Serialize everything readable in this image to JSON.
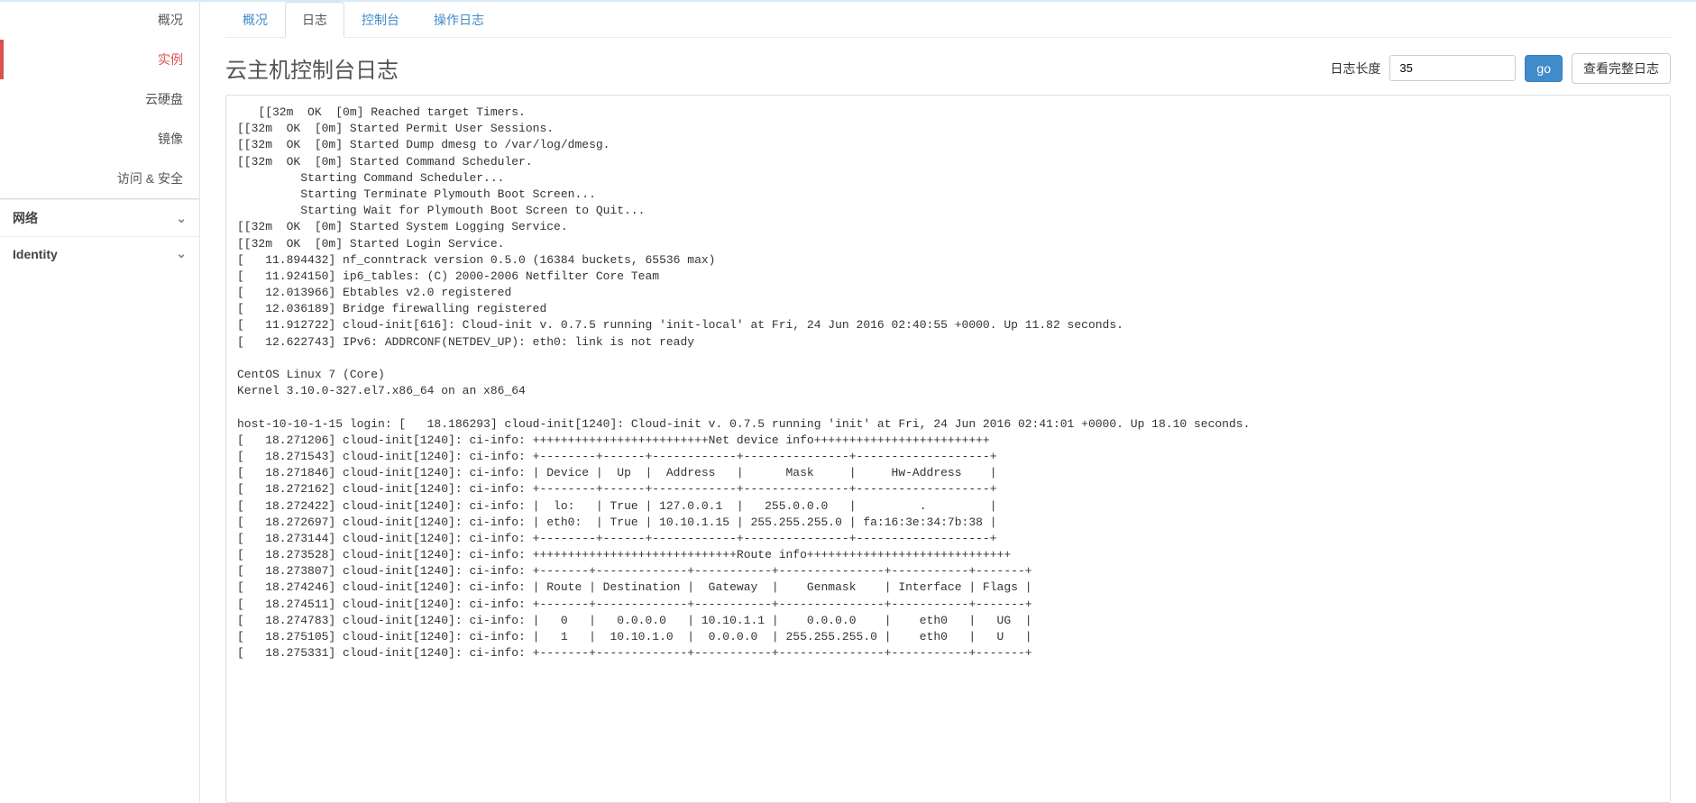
{
  "sidebar": {
    "items": [
      {
        "label": "概况"
      },
      {
        "label": "实例"
      },
      {
        "label": "云硬盘"
      },
      {
        "label": "镜像"
      },
      {
        "label": "访问 & 安全"
      }
    ],
    "groups": [
      {
        "label": "网络"
      },
      {
        "label": "Identity"
      }
    ]
  },
  "tabs": [
    {
      "label": "概况"
    },
    {
      "label": "日志"
    },
    {
      "label": "控制台"
    },
    {
      "label": "操作日志"
    }
  ],
  "page_title": "云主机控制台日志",
  "log_length": {
    "label": "日志长度",
    "value": "35"
  },
  "buttons": {
    "go": "go",
    "view_full": "查看完整日志"
  },
  "log_lines": [
    "   [[32m  OK  [0m] Reached target Timers.",
    "[[32m  OK  [0m] Started Permit User Sessions.",
    "[[32m  OK  [0m] Started Dump dmesg to /var/log/dmesg.",
    "[[32m  OK  [0m] Started Command Scheduler.",
    "         Starting Command Scheduler...",
    "         Starting Terminate Plymouth Boot Screen...",
    "         Starting Wait for Plymouth Boot Screen to Quit...",
    "[[32m  OK  [0m] Started System Logging Service.",
    "[[32m  OK  [0m] Started Login Service.",
    "[   11.894432] nf_conntrack version 0.5.0 (16384 buckets, 65536 max)",
    "[   11.924150] ip6_tables: (C) 2000-2006 Netfilter Core Team",
    "[   12.013966] Ebtables v2.0 registered",
    "[   12.036189] Bridge firewalling registered",
    "[   11.912722] cloud-init[616]: Cloud-init v. 0.7.5 running 'init-local' at Fri, 24 Jun 2016 02:40:55 +0000. Up 11.82 seconds.",
    "[   12.622743] IPv6: ADDRCONF(NETDEV_UP): eth0: link is not ready",
    "",
    "CentOS Linux 7 (Core)",
    "Kernel 3.10.0-327.el7.x86_64 on an x86_64",
    "",
    "host-10-10-1-15 login: [   18.186293] cloud-init[1240]: Cloud-init v. 0.7.5 running 'init' at Fri, 24 Jun 2016 02:41:01 +0000. Up 18.10 seconds.",
    "[   18.271206] cloud-init[1240]: ci-info: +++++++++++++++++++++++++Net device info+++++++++++++++++++++++++",
    "[   18.271543] cloud-init[1240]: ci-info: +--------+------+------------+---------------+-------------------+",
    "[   18.271846] cloud-init[1240]: ci-info: | Device |  Up  |  Address   |      Mask     |     Hw-Address    |",
    "[   18.272162] cloud-init[1240]: ci-info: +--------+------+------------+---------------+-------------------+",
    "[   18.272422] cloud-init[1240]: ci-info: |  lo:   | True | 127.0.0.1  |   255.0.0.0   |         .         |",
    "[   18.272697] cloud-init[1240]: ci-info: | eth0:  | True | 10.10.1.15 | 255.255.255.0 | fa:16:3e:34:7b:38 |",
    "[   18.273144] cloud-init[1240]: ci-info: +--------+------+------------+---------------+-------------------+",
    "[   18.273528] cloud-init[1240]: ci-info: +++++++++++++++++++++++++++++Route info+++++++++++++++++++++++++++++",
    "[   18.273807] cloud-init[1240]: ci-info: +-------+-------------+-----------+---------------+-----------+-------+",
    "[   18.274246] cloud-init[1240]: ci-info: | Route | Destination |  Gateway  |    Genmask    | Interface | Flags |",
    "[   18.274511] cloud-init[1240]: ci-info: +-------+-------------+-----------+---------------+-----------+-------+",
    "[   18.274783] cloud-init[1240]: ci-info: |   0   |   0.0.0.0   | 10.10.1.1 |    0.0.0.0    |    eth0   |   UG  |",
    "[   18.275105] cloud-init[1240]: ci-info: |   1   |  10.10.1.0  |  0.0.0.0  | 255.255.255.0 |    eth0   |   U   |",
    "[   18.275331] cloud-init[1240]: ci-info: +-------+-------------+-----------+---------------+-----------+-------+"
  ]
}
